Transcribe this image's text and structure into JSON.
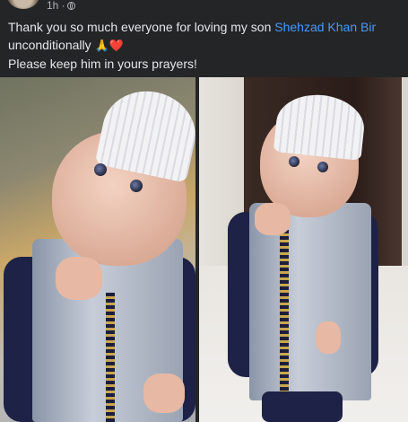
{
  "post": {
    "timestamp": "1h ·",
    "text_line1": "Thank you so much everyone for loving my son ",
    "mention": "Shehzad Khan Bir",
    "text_line2": "unconditionally",
    "emojis": "🙏❤️",
    "text_line3": "Please keep him in yours prayers!"
  },
  "icons": {
    "audience": "globe-icon"
  },
  "colors": {
    "background": "#242526",
    "text": "#e4e6eb",
    "secondary_text": "#b0b3b8",
    "link": "#4599ff"
  }
}
